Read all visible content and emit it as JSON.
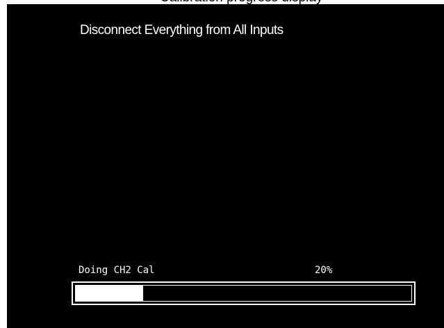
{
  "screen": {
    "title": "Disconnect Everything from All Inputs",
    "status_label": "Doing CH2 Cal",
    "progress_percent_label": "20%",
    "progress_value": 0.2
  },
  "colors": {
    "background": "#000000",
    "foreground": "#ffffff"
  }
}
